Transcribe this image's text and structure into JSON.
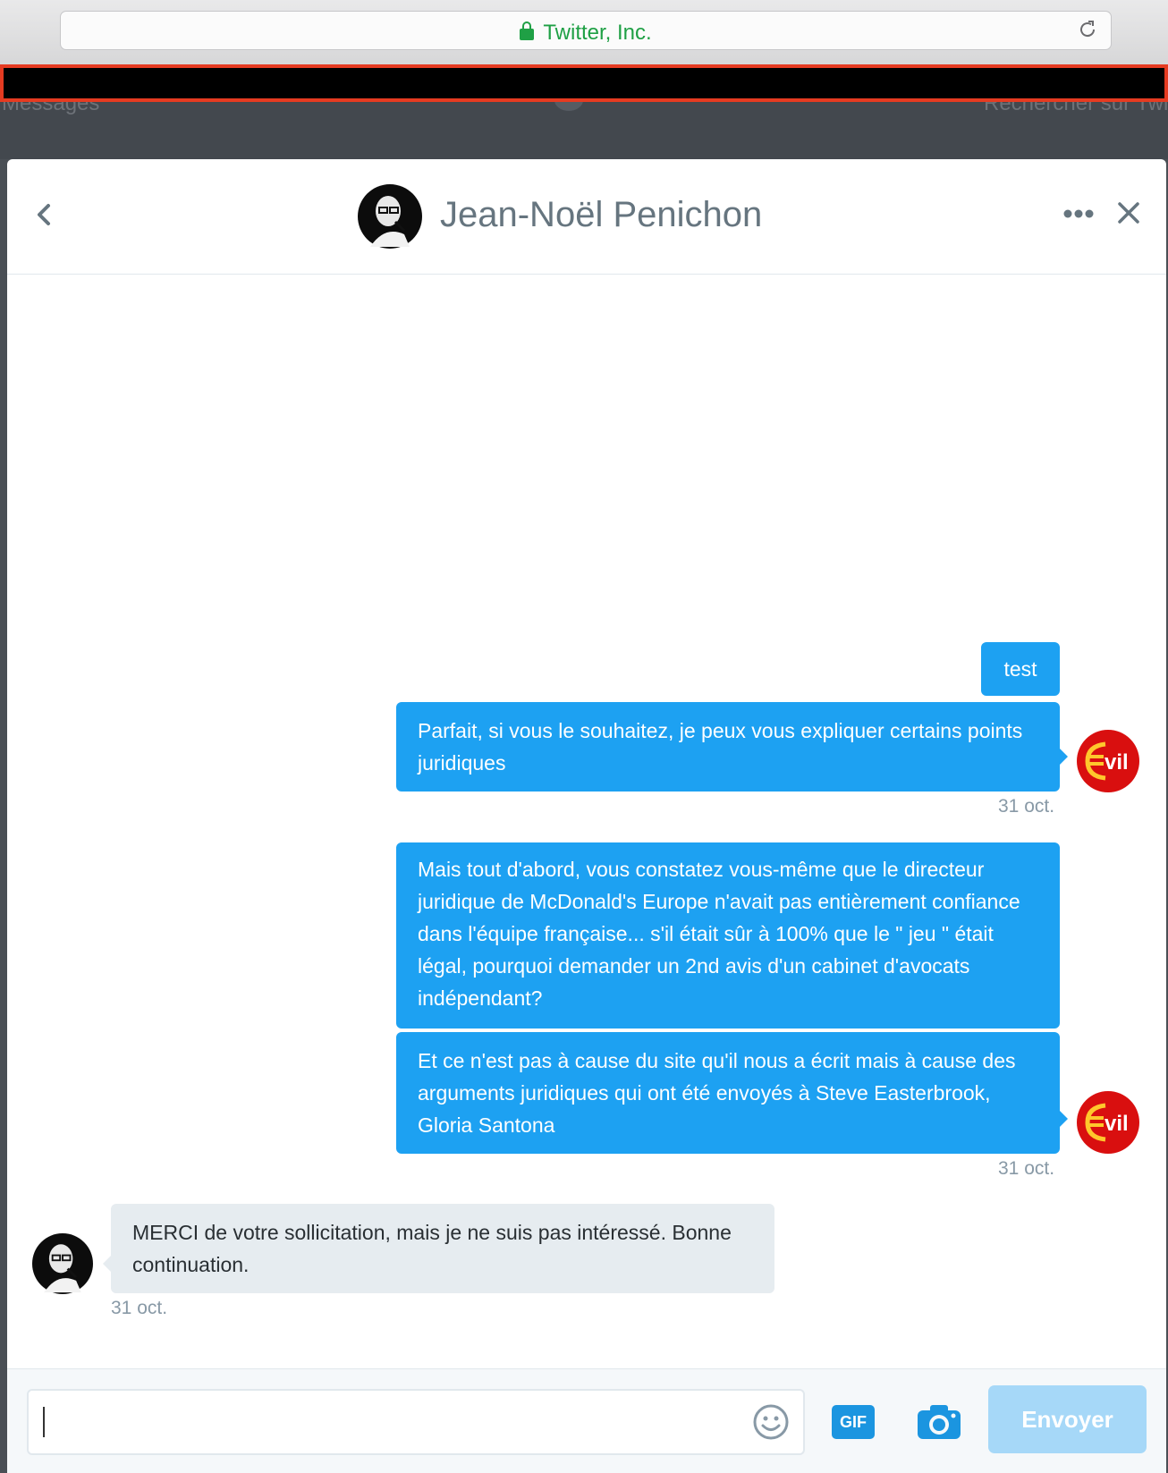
{
  "browser": {
    "address": "Twitter, Inc."
  },
  "background_nav": {
    "left": "Messages",
    "right": "Rechercher sur Twitter"
  },
  "conversation": {
    "contact_name": "Jean-Noël Penichon",
    "messages": [
      {
        "text": "test",
        "side": "sent"
      },
      {
        "text": "Parfait, si vous le souhaitez, je peux vous expliquer certains points juridiques",
        "side": "sent",
        "time": "31 oct."
      },
      {
        "text": "Mais tout d'abord, vous constatez vous-même que le directeur juridique de McDonald's Europe n'avait pas entièrement confiance dans l'équipe française... s'il était sûr à 100% que le \" jeu \" était légal, pourquoi demander un 2nd avis d'un cabinet d'avocats indépendant?",
        "side": "sent"
      },
      {
        "text": "Et ce n'est pas à cause du site qu'il nous a écrit mais à cause des arguments juridiques qui ont été envoyés à Steve Easterbrook, Gloria Santona",
        "side": "sent",
        "time": "31 oct."
      },
      {
        "text": "MERCI de votre sollicitation, mais je ne suis pas intéressé. Bonne continuation.",
        "side": "received",
        "time": "31 oct."
      }
    ],
    "avatar_badge_text": "vil"
  },
  "composer": {
    "input_value": "",
    "gif_label": "GIF",
    "send_label": "Envoyer"
  },
  "colors": {
    "accent": "#1da1f2",
    "received_bubble": "#e6ecf0",
    "secure": "#1fa045",
    "send_disabled": "#a6d8f8"
  }
}
